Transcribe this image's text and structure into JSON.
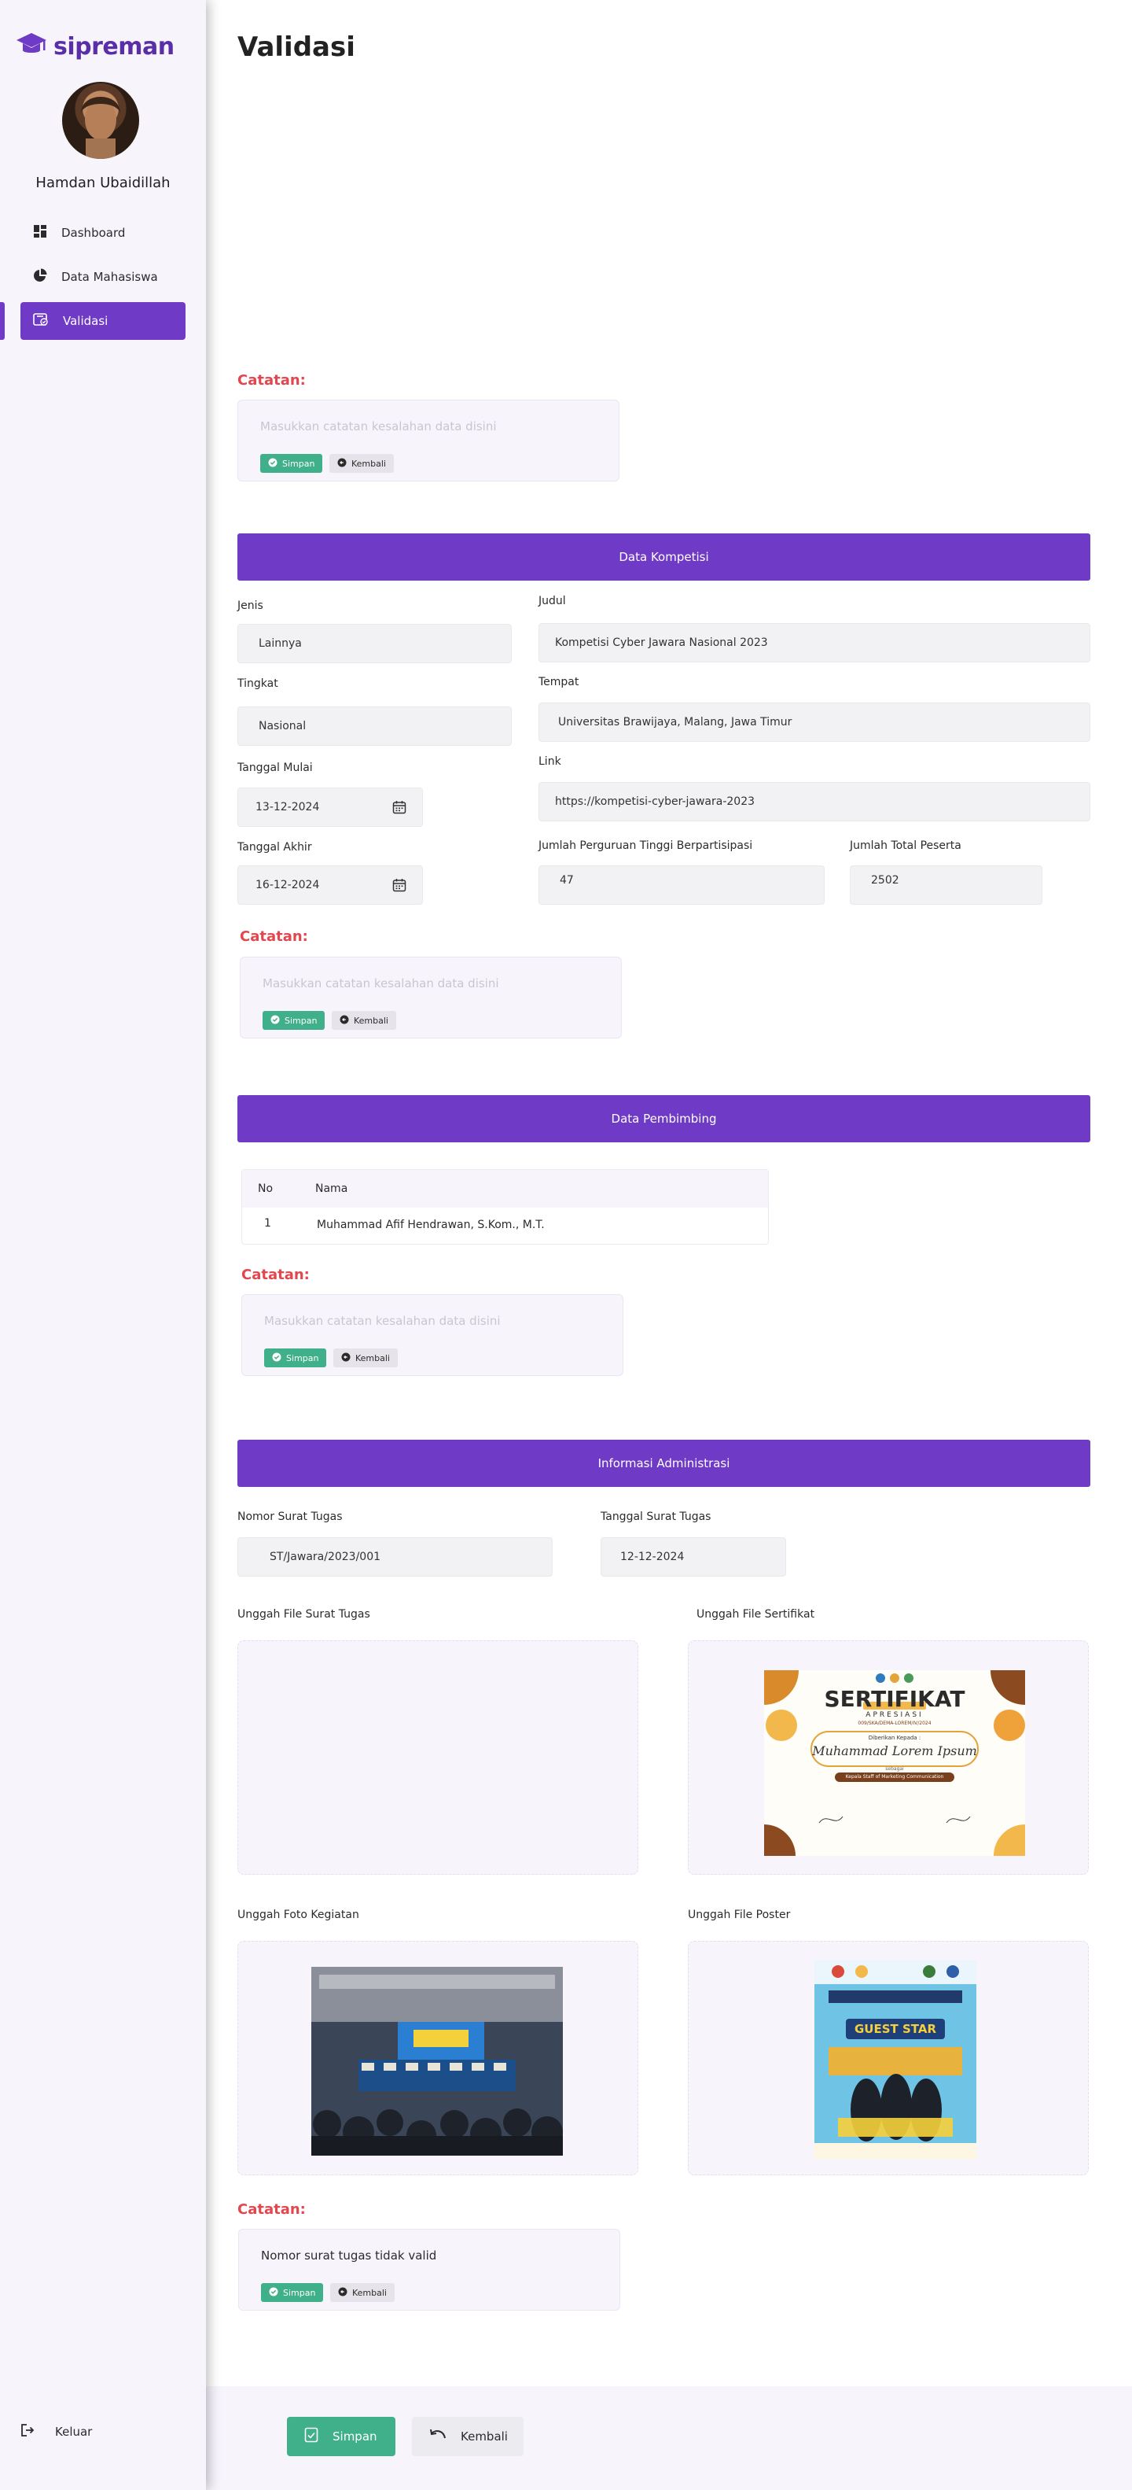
{
  "app": {
    "name": "sipreman"
  },
  "user": {
    "name": "Hamdan Ubaidillah"
  },
  "sidebar": {
    "items": [
      {
        "label": "Dashboard",
        "icon": "dashboard-icon"
      },
      {
        "label": "Data Mahasiswa",
        "icon": "pie-chart-icon"
      },
      {
        "label": "Validasi",
        "icon": "validate-icon",
        "active": true
      }
    ],
    "logout_label": "Keluar"
  },
  "page": {
    "title": "Validasi"
  },
  "notes": {
    "label": "Catatan:",
    "placeholder": "Masukkan catatan kesalahan data disini",
    "save_label": "Simpan",
    "back_label": "Kembali",
    "admin_note_value": "Nomor surat tugas tidak valid"
  },
  "kompetisi": {
    "section_title": "Data Kompetisi",
    "jenis_label": "Jenis",
    "jenis_value": "Lainnya",
    "judul_label": "Judul",
    "judul_value": "Kompetisi Cyber Jawara Nasional 2023",
    "tingkat_label": "Tingkat",
    "tingkat_value": "Nasional",
    "tempat_label": "Tempat",
    "tempat_value": "Universitas Brawijaya, Malang, Jawa Timur",
    "tanggal_mulai_label": "Tanggal Mulai",
    "tanggal_mulai_value": "13-12-2024",
    "link_label": "Link",
    "link_value": "https://kompetisi-cyber-jawara-2023",
    "tanggal_akhir_label": "Tanggal Akhir",
    "tanggal_akhir_value": "16-12-2024",
    "jumlah_pt_label": "Jumlah Perguruan Tinggi Berpartisipasi",
    "jumlah_pt_value": "47",
    "jumlah_peserta_label": "Jumlah Total Peserta",
    "jumlah_peserta_value": "2502"
  },
  "pembimbing": {
    "section_title": "Data Pembimbing",
    "columns": [
      "No",
      "Nama"
    ],
    "rows": [
      {
        "no": "1",
        "nama": "Muhammad Afif Hendrawan, S.Kom., M.T."
      }
    ]
  },
  "administrasi": {
    "section_title": "Informasi Administrasi",
    "nomor_label": "Nomor Surat Tugas",
    "nomor_value": "ST/Jawara/2023/001",
    "tanggal_label": "Tanggal Surat Tugas",
    "tanggal_value": "12-12-2024",
    "upload_surat_label": "Unggah File Surat Tugas",
    "upload_sertifikat_label": "Unggah File Sertifikat",
    "upload_foto_label": "Unggah Foto Kegiatan",
    "upload_poster_label": "Unggah File Poster",
    "certificate": {
      "title": "SERTIFIKAT",
      "subtitle": "APRESIASI",
      "number": "009/SKA/DEMA-LOREM/IV/2024",
      "given_to": "Diberikan Kepada :",
      "recipient": "Muhammad Lorem Ipsum",
      "as_label": "sebagai",
      "role": "Kepala Staff of Marketing Communication"
    },
    "poster": {
      "headline": "GUEST STAR"
    }
  },
  "footer": {
    "save_label": "Simpan",
    "back_label": "Kembali"
  },
  "colors": {
    "primary": "#6f3ac6",
    "save": "#3fb08a",
    "danger": "#e0474f",
    "sidebar_bg": "#f7f4fc"
  }
}
